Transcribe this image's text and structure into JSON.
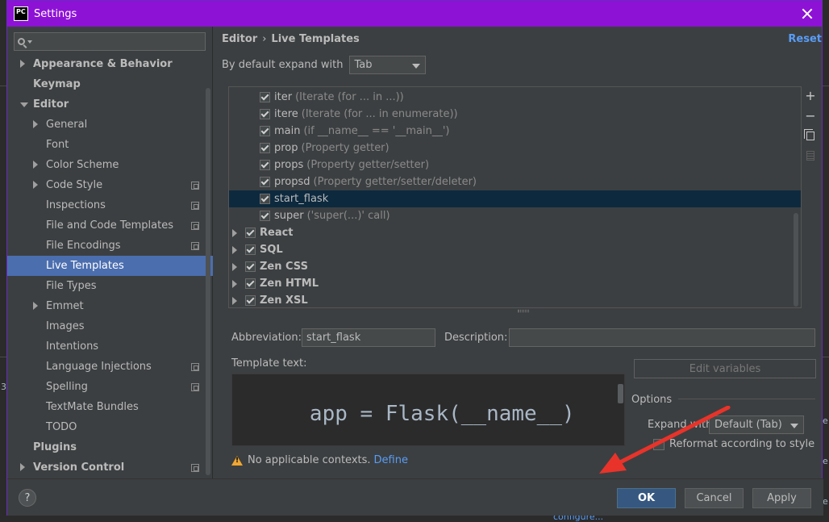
{
  "window": {
    "title": "Settings",
    "app_icon_text": "PC"
  },
  "sidebar": {
    "items": [
      {
        "label": "Appearance & Behavior",
        "level": 0,
        "arrow": "right",
        "bold": true,
        "icon": false
      },
      {
        "label": "Keymap",
        "level": 0,
        "arrow": "",
        "bold": true,
        "icon": false
      },
      {
        "label": "Editor",
        "level": 0,
        "arrow": "down",
        "bold": true,
        "icon": false
      },
      {
        "label": "General",
        "level": 1,
        "arrow": "right",
        "bold": false,
        "icon": false
      },
      {
        "label": "Font",
        "level": 1,
        "arrow": "",
        "bold": false,
        "icon": false
      },
      {
        "label": "Color Scheme",
        "level": 1,
        "arrow": "right",
        "bold": false,
        "icon": false
      },
      {
        "label": "Code Style",
        "level": 1,
        "arrow": "right",
        "bold": false,
        "icon": true
      },
      {
        "label": "Inspections",
        "level": 1,
        "arrow": "",
        "bold": false,
        "icon": true
      },
      {
        "label": "File and Code Templates",
        "level": 1,
        "arrow": "",
        "bold": false,
        "icon": true
      },
      {
        "label": "File Encodings",
        "level": 1,
        "arrow": "",
        "bold": false,
        "icon": true
      },
      {
        "label": "Live Templates",
        "level": 1,
        "arrow": "",
        "bold": false,
        "icon": false,
        "selected": true
      },
      {
        "label": "File Types",
        "level": 1,
        "arrow": "",
        "bold": false,
        "icon": false
      },
      {
        "label": "Emmet",
        "level": 1,
        "arrow": "right",
        "bold": false,
        "icon": false
      },
      {
        "label": "Images",
        "level": 1,
        "arrow": "",
        "bold": false,
        "icon": false
      },
      {
        "label": "Intentions",
        "level": 1,
        "arrow": "",
        "bold": false,
        "icon": false
      },
      {
        "label": "Language Injections",
        "level": 1,
        "arrow": "",
        "bold": false,
        "icon": true
      },
      {
        "label": "Spelling",
        "level": 1,
        "arrow": "",
        "bold": false,
        "icon": true
      },
      {
        "label": "TextMate Bundles",
        "level": 1,
        "arrow": "",
        "bold": false,
        "icon": false
      },
      {
        "label": "TODO",
        "level": 1,
        "arrow": "",
        "bold": false,
        "icon": false
      },
      {
        "label": "Plugins",
        "level": 0,
        "arrow": "",
        "bold": true,
        "icon": false
      },
      {
        "label": "Version Control",
        "level": 0,
        "arrow": "right",
        "bold": true,
        "icon": true
      }
    ]
  },
  "main": {
    "breadcrumb": {
      "part1": "Editor",
      "separator": "›",
      "part2": "Live Templates"
    },
    "reset_label": "Reset",
    "expand_label": "By default expand with",
    "expand_value": "Tab",
    "templates": [
      {
        "name": "iter",
        "desc": "(Iterate (for ... in ...))",
        "kind": "item"
      },
      {
        "name": "itere",
        "desc": "(Iterate (for ... in enumerate))",
        "kind": "item"
      },
      {
        "name": "main",
        "desc": "(if __name__ == '__main__')",
        "kind": "item"
      },
      {
        "name": "prop",
        "desc": "(Property getter)",
        "kind": "item"
      },
      {
        "name": "props",
        "desc": "(Property getter/setter)",
        "kind": "item"
      },
      {
        "name": "propsd",
        "desc": "(Property getter/setter/deleter)",
        "kind": "item"
      },
      {
        "name": "start_flask",
        "desc": "",
        "kind": "item",
        "selected": true
      },
      {
        "name": "super",
        "desc": "('super(...)' call)",
        "kind": "item"
      },
      {
        "name": "React",
        "desc": "",
        "kind": "group"
      },
      {
        "name": "SQL",
        "desc": "",
        "kind": "group"
      },
      {
        "name": "Zen CSS",
        "desc": "",
        "kind": "group"
      },
      {
        "name": "Zen HTML",
        "desc": "",
        "kind": "group"
      },
      {
        "name": "Zen XSL",
        "desc": "",
        "kind": "group"
      }
    ],
    "tools": {
      "add": "+",
      "remove": "−"
    },
    "abbreviation_label": "Abbreviation:",
    "abbreviation_value": "start_flask",
    "description_label": "Description:",
    "description_value": "",
    "template_text_label": "Template text:",
    "template_text": "app = Flask(__name__)",
    "edit_variables_label": "Edit variables",
    "options_title": "Options",
    "expand_with_label": "Expand with",
    "expand_with_value": "Default (Tab)",
    "reformat_label": "Reformat according to style",
    "warning_text": "No applicable contexts.",
    "define_label": "Define"
  },
  "footer": {
    "help_label": "?",
    "ok_label": "OK",
    "cancel_label": "Cancel",
    "apply_label": "Apply"
  },
  "background": {
    "bottom_text": "configure...",
    "left_char": "3",
    "right_chars": [
      "e",
      "e",
      "e"
    ]
  },
  "colors": {
    "titlebar": "#8d12d6",
    "selection": "#4b6eaf",
    "link": "#589df6",
    "arrow_annotation": "#e8332a"
  }
}
